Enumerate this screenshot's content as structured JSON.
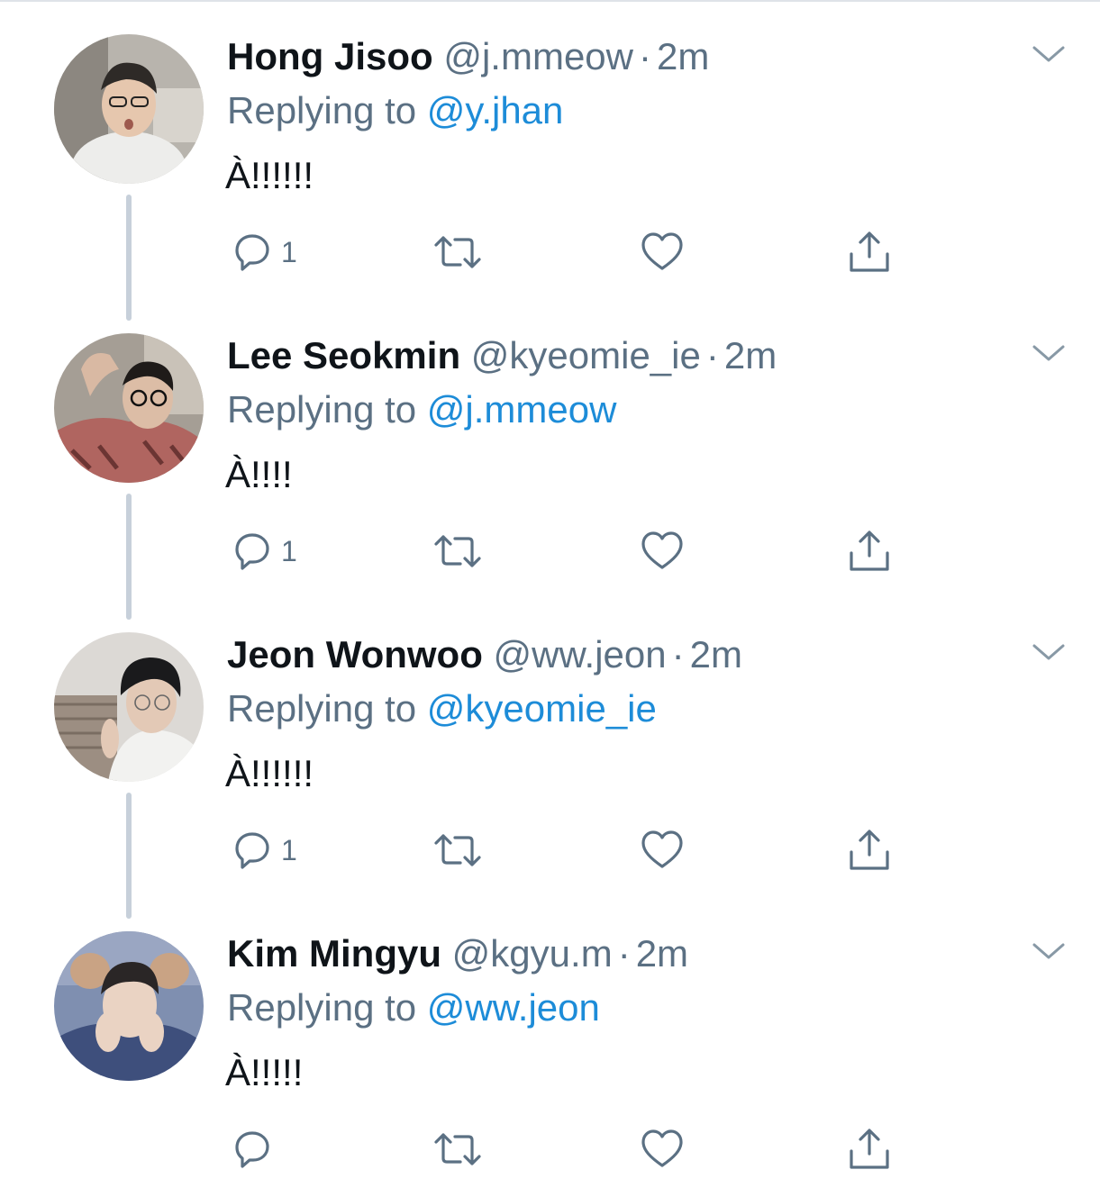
{
  "colors": {
    "name": "#0f1419",
    "meta": "#5b7083",
    "link": "#1d8cd8",
    "thread_line": "#c7d0da"
  },
  "icons": {
    "reply": "reply-icon",
    "retweet": "retweet-icon",
    "like": "heart-icon",
    "share": "share-icon",
    "more": "chevron-down-icon"
  },
  "tweets": [
    {
      "name": "Hong Jisoo",
      "handle": "@j.mmeow",
      "separator": "·",
      "time": "2m",
      "replying_prefix": "Replying to",
      "replying_to": "@y.jhan",
      "text": "À!!!!!!",
      "reply_count": "1"
    },
    {
      "name": "Lee Seokmin",
      "handle": "@kyeomie_ie",
      "separator": "·",
      "time": "2m",
      "replying_prefix": "Replying to",
      "replying_to": "@j.mmeow",
      "text": "À!!!!",
      "reply_count": "1"
    },
    {
      "name": "Jeon Wonwoo",
      "handle": "@ww.jeon",
      "separator": "·",
      "time": "2m",
      "replying_prefix": "Replying to",
      "replying_to": "@kyeomie_ie",
      "text": "À!!!!!!",
      "reply_count": "1"
    },
    {
      "name": "Kim Mingyu",
      "handle": "@kgyu.m",
      "separator": "·",
      "time": "2m",
      "replying_prefix": "Replying to",
      "replying_to": "@ww.jeon",
      "text": "À!!!!!",
      "reply_count": ""
    }
  ]
}
